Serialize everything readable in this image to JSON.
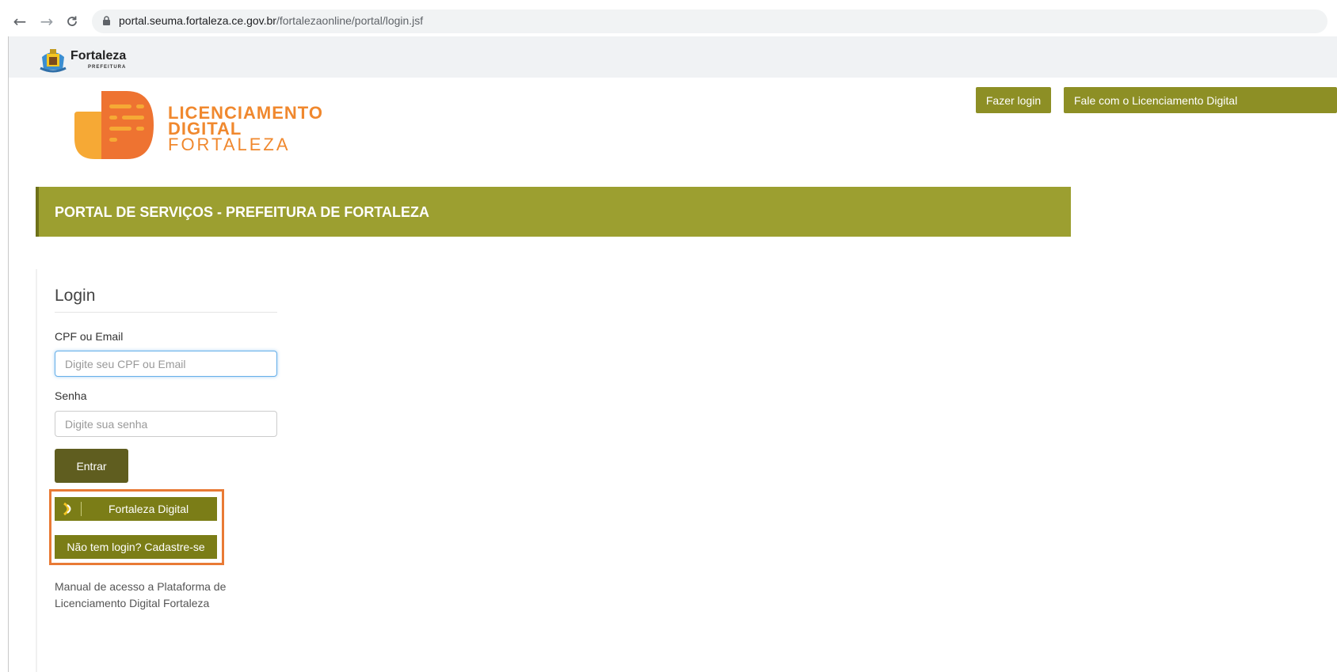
{
  "browser": {
    "url_domain": "portal.seuma.fortaleza.ce.gov.br",
    "url_path": "/fortalezaonline/portal/login.jsf",
    "back_icon": "arrow-left-icon",
    "forward_icon": "arrow-right-icon",
    "reload_icon": "reload-icon",
    "lock_icon": "lock-icon"
  },
  "prefeitura": {
    "name": "Fortaleza",
    "subtitle": "PREFEITURA"
  },
  "brand": {
    "line1": "LICENCIAMENTO",
    "line2": "DIGITAL",
    "line3": "FORTALEZA"
  },
  "header_buttons": {
    "login": "Fazer login",
    "contact": "Fale com o Licenciamento Digital"
  },
  "banner": {
    "title": "PORTAL DE SERVIÇOS - PREFEITURA DE FORTALEZA"
  },
  "login": {
    "title": "Login",
    "user_label": "CPF ou Email",
    "user_placeholder": "Digite seu CPF ou Email",
    "password_label": "Senha",
    "password_placeholder": "Digite sua senha",
    "submit": "Entrar",
    "fortaleza_digital": "Fortaleza Digital",
    "register": "Não tem login? Cadastre-se",
    "manual": "Manual de acesso a Plataforma de Licenciamento Digital Fortaleza"
  },
  "colors": {
    "olive": "#9c9f30",
    "olive_dark": "#5f5d1f",
    "orange": "#f0882e",
    "highlight": "#e97a35"
  }
}
